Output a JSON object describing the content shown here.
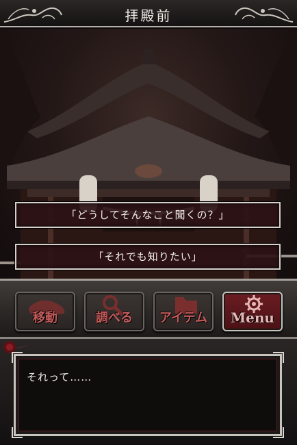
{
  "header": {
    "title": "拝殿前"
  },
  "scene": {
    "name": "shrine-worship-hall-night"
  },
  "choices": [
    {
      "label": "「どうしてそんなこと聞くの？」"
    },
    {
      "label": "「それでも知りたい」"
    }
  ],
  "commands": {
    "move": {
      "label": "移動",
      "icon": "footprint-icon"
    },
    "examine": {
      "label": "調べる",
      "icon": "magnifier-icon"
    },
    "items": {
      "label": "アイテム",
      "icon": "folder-icon"
    },
    "menu": {
      "label": "Menu",
      "icon": "gear-icon"
    }
  },
  "dialog": {
    "text": "それって……"
  },
  "colors": {
    "accent_red": "#c35b5b",
    "frame_silver": "#c9c3be",
    "choice_bg": "#2d1216"
  }
}
